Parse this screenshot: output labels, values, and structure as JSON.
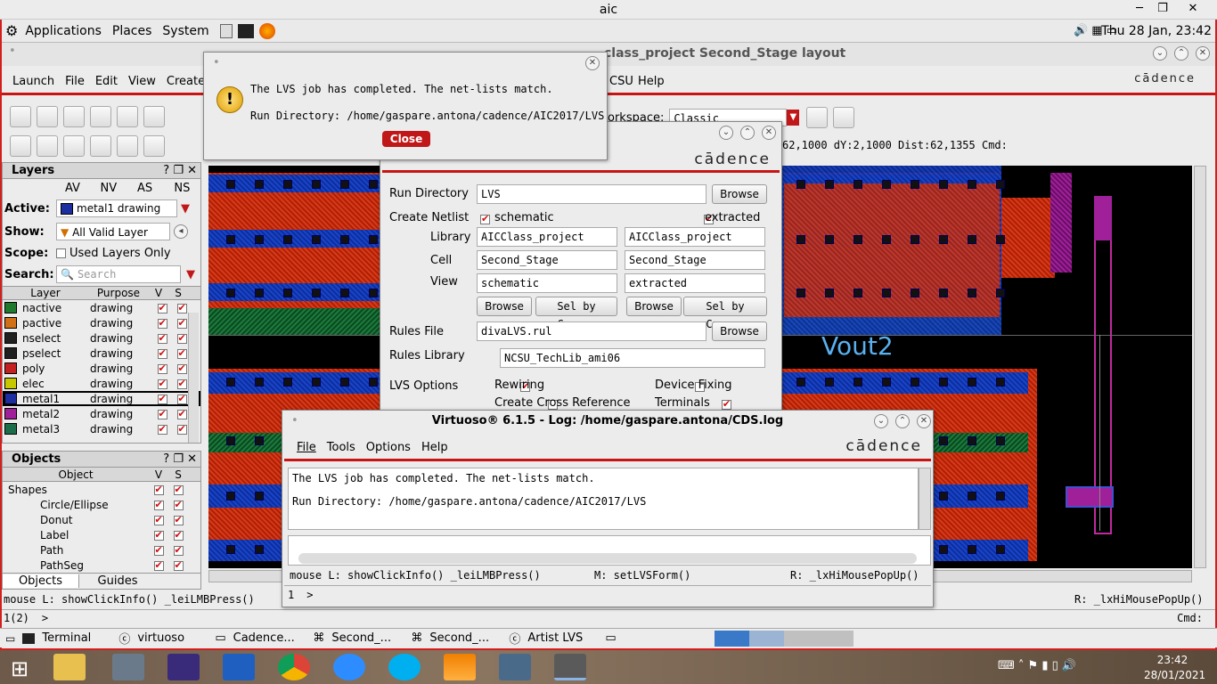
{
  "window": {
    "title": "aic"
  },
  "gnome_panel": {
    "menus": [
      "Applications",
      "Places",
      "System"
    ],
    "clock": "Thu 28 Jan, 23:42"
  },
  "virtuoso_main": {
    "title": "class_project Second_Stage layout",
    "menu": [
      "Launch",
      "File",
      "Edit",
      "View",
      "Create",
      "CSU",
      "Help"
    ],
    "workspace_label": "orkspace:",
    "workspace_value": "Classic",
    "status_coords": "62,1000  dY:2,1000  Dist:62,1355  Cmd:",
    "canvas_label": "Vout2",
    "bottom_mouse_left": "mouse L: showClickInfo() _leiLMBPress()",
    "bottom_mouse_right": "R: _lxHiMousePopUp()",
    "cmd_line_prefix": "1(2)",
    "cmd_label": "Cmd:"
  },
  "layers_panel": {
    "title": "Layers",
    "vis_cols": [
      "AV",
      "NV",
      "AS",
      "NS"
    ],
    "active_label": "Active:",
    "active_value": "metal1 drawing",
    "show_label": "Show:",
    "show_value": "All Valid Layer",
    "scope_label": "Scope:",
    "scope_value": "Used Layers Only",
    "search_label": "Search:",
    "search_placeholder": "Search",
    "columns": [
      "Layer",
      "Purpose",
      "V",
      "S"
    ],
    "rows": [
      {
        "name": "nactive",
        "purpose": "drawing",
        "color": "#1f7a2e"
      },
      {
        "name": "pactive",
        "purpose": "drawing",
        "color": "#d27018"
      },
      {
        "name": "nselect",
        "purpose": "drawing",
        "color": "#202020"
      },
      {
        "name": "pselect",
        "purpose": "drawing",
        "color": "#202020"
      },
      {
        "name": "poly",
        "purpose": "drawing",
        "color": "#c42020"
      },
      {
        "name": "elec",
        "purpose": "drawing",
        "color": "#c8c800"
      },
      {
        "name": "metal1",
        "purpose": "drawing",
        "color": "#1c2ea0"
      },
      {
        "name": "metal2",
        "purpose": "drawing",
        "color": "#a0209a"
      },
      {
        "name": "metal3",
        "purpose": "drawing",
        "color": "#1c6e4a"
      }
    ]
  },
  "objects_panel": {
    "title": "Objects",
    "columns": [
      "Object",
      "V",
      "S"
    ],
    "rows": [
      "Shapes",
      "Circle/Ellipse",
      "Donut",
      "Label",
      "Path",
      "PathSeg"
    ],
    "tabs": [
      "Objects",
      "Guides"
    ]
  },
  "lvs_popup": {
    "message": "The LVS job has completed. The net-lists match.",
    "run_dir": "Run Directory: /home/gaspare.antona/cadence/AIC2017/LVS",
    "close_label": "Close"
  },
  "lvs_form": {
    "run_directory_label": "Run Directory",
    "run_directory_value": "LVS",
    "browse": "Browse",
    "create_netlist_label": "Create Netlist",
    "schematic_label": "schematic",
    "extracted_label": "extracted",
    "library_label": "Library",
    "cell_label": "Cell",
    "view_label": "View",
    "sch_library": "AICClass_project",
    "sch_cell": "Second_Stage",
    "sch_view": "schematic",
    "ext_library": "AICClass_project",
    "ext_cell": "Second_Stage",
    "ext_view": "extracted",
    "sel_by_cursor": "Sel by Cursor",
    "rules_file_label": "Rules File",
    "rules_file_value": "divaLVS.rul",
    "rules_library_label": "Rules Library",
    "rules_library_value": "NCSU_TechLib_ami06",
    "lvs_options_label": "LVS Options",
    "rewiring": "Rewiring",
    "device_fixing": "Device Fixing",
    "cross_ref": "Create Cross Reference",
    "terminals": "Terminals"
  },
  "log_window": {
    "title": "Virtuoso® 6.1.5 - Log: /home/gaspare.antona/CDS.log",
    "menu": [
      "File",
      "Tools",
      "Options",
      "Help"
    ],
    "line1": "The LVS job has completed. The net-lists match.",
    "line2": "Run Directory: /home/gaspare.antona/cadence/AIC2017/LVS",
    "mouse_l": "mouse L: showClickInfo() _leiLMBPress()",
    "mouse_m": "M: setLVSForm()",
    "mouse_r": "R: _lxHiMousePopUp()",
    "prompt_num": "1",
    "prompt": ">"
  },
  "cadence_logo": "cādence",
  "gnome_taskbar": {
    "items": [
      "Terminal",
      "virtuoso",
      "Cadence...",
      "Second_...",
      "Second_...",
      "Artist LVS"
    ]
  },
  "windows_taskbar": {
    "time": "23:42",
    "date": "28/01/2021"
  }
}
